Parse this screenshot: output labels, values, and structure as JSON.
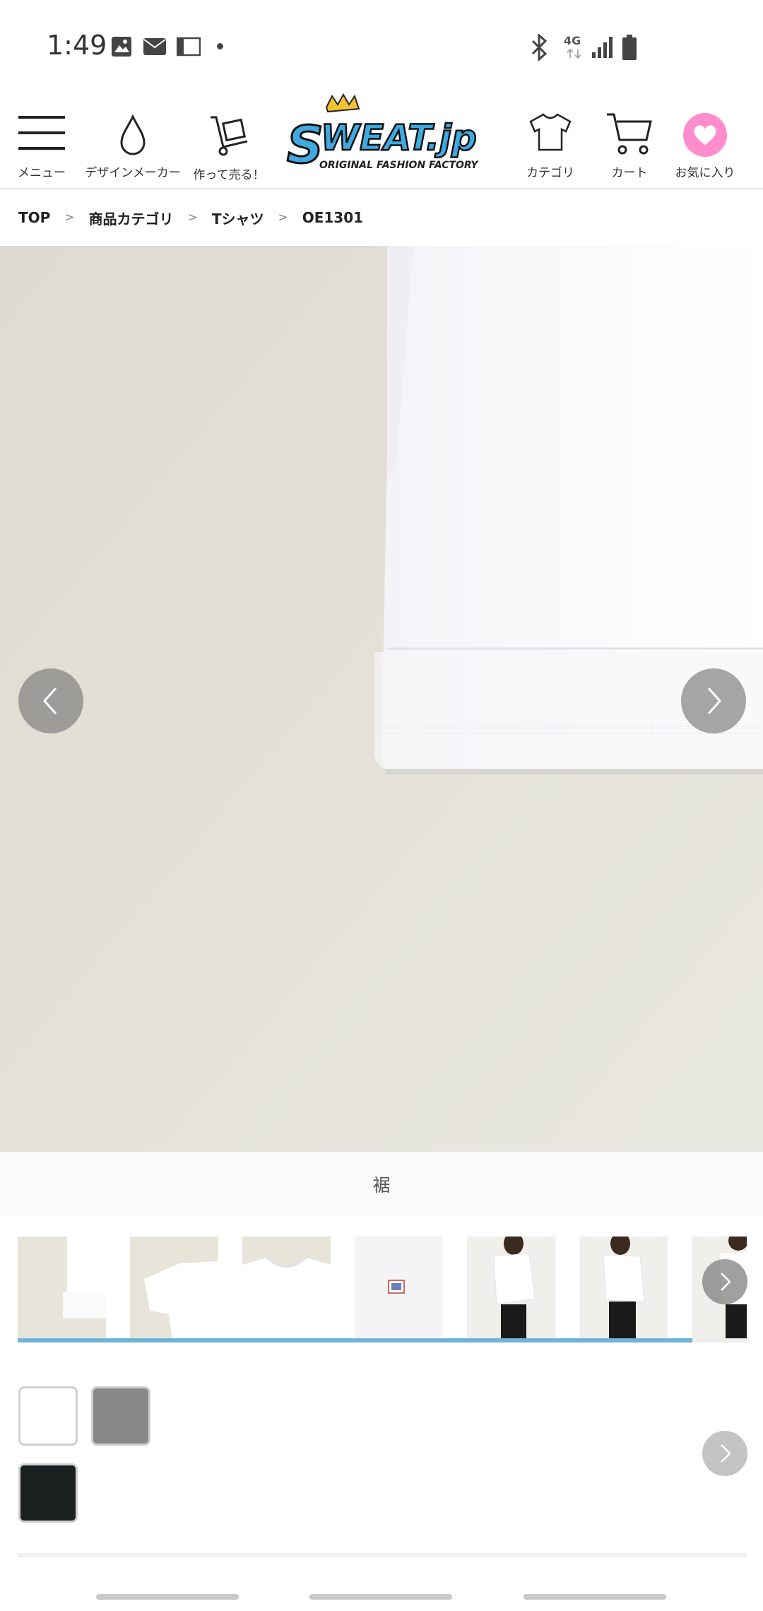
{
  "status_bar": {
    "time": "1:49",
    "left_icons": [
      "image-icon",
      "mail-icon",
      "au-wallet-icon",
      "dot-icon"
    ],
    "right_icons": [
      "bluetooth-icon",
      "4g-icon",
      "signal-icon",
      "battery-icon"
    ],
    "network_label": "4G"
  },
  "header": {
    "menu_label": "メニュー",
    "design_label": "デザインメーカー",
    "sell_label": "作って売る！",
    "logo_text": "SWEAT.jp",
    "logo_sub": "ORIGINAL FASHION FACTORY",
    "category_label": "カテゴリ",
    "cart_label": "カート",
    "favorite_label": "お気に入り",
    "accent_color": "#ff8ccd"
  },
  "breadcrumb": {
    "items": [
      "TOP",
      "商品カテゴリ",
      "Tシャツ",
      "OE1301"
    ],
    "separator": ">"
  },
  "gallery": {
    "caption": "裾",
    "progress": 0.925,
    "thumbnails": [
      "hem",
      "folded-sleeve",
      "collar",
      "tag",
      "side-view",
      "side-view-2",
      "back-view"
    ],
    "progress_color": "#6fb3d9"
  },
  "colors": {
    "swatches": [
      "#ffffff",
      "#888888",
      "#1b1f20"
    ]
  }
}
